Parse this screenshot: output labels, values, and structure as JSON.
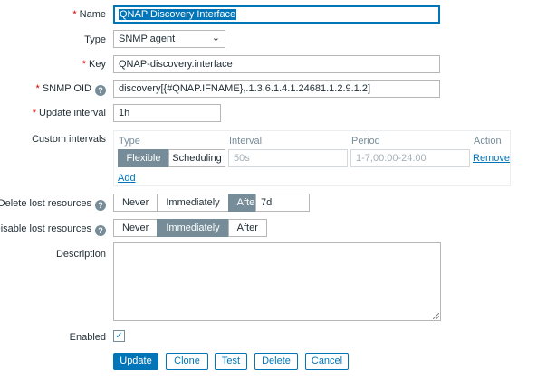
{
  "form": {
    "name": {
      "label": "Name",
      "value": "QNAP Discovery Interface"
    },
    "type": {
      "label": "Type",
      "value": "SNMP agent"
    },
    "key": {
      "label": "Key",
      "value": "QNAP-discovery.interface"
    },
    "snmp_oid": {
      "label": "SNMP OID",
      "value": "discovery[{#QNAP.IFNAME},.1.3.6.1.4.1.24681.1.2.9.1.2]"
    },
    "update_interval": {
      "label": "Update interval",
      "value": "1h"
    },
    "custom_intervals": {
      "label": "Custom intervals",
      "headers": {
        "type": "Type",
        "interval": "Interval",
        "period": "Period",
        "action": "Action"
      },
      "row": {
        "type_options": [
          "Flexible",
          "Scheduling"
        ],
        "type_selected": "Flexible",
        "interval_placeholder": "50s",
        "period_placeholder": "1-7,00:00-24:00",
        "remove_label": "Remove"
      },
      "add_label": "Add"
    },
    "delete_lost": {
      "label": "Delete lost resources",
      "options": [
        "Never",
        "Immediately",
        "After"
      ],
      "selected": "After",
      "after_value": "7d"
    },
    "disable_lost": {
      "label": "Disable lost resources",
      "options": [
        "Never",
        "Immediately",
        "After"
      ],
      "selected": "Immediately"
    },
    "description": {
      "label": "Description",
      "value": ""
    },
    "enabled": {
      "label": "Enabled",
      "checked": true
    }
  },
  "buttons": {
    "update": "Update",
    "clone": "Clone",
    "test": "Test",
    "delete": "Delete",
    "cancel": "Cancel"
  },
  "icons": {
    "help": "help-icon",
    "select": "chevron-down-icon",
    "check": "check-icon",
    "resize": "resize-grip-icon"
  },
  "colors": {
    "accent": "#0275b8",
    "required": "#d40000",
    "segment_active": "#768d99"
  }
}
